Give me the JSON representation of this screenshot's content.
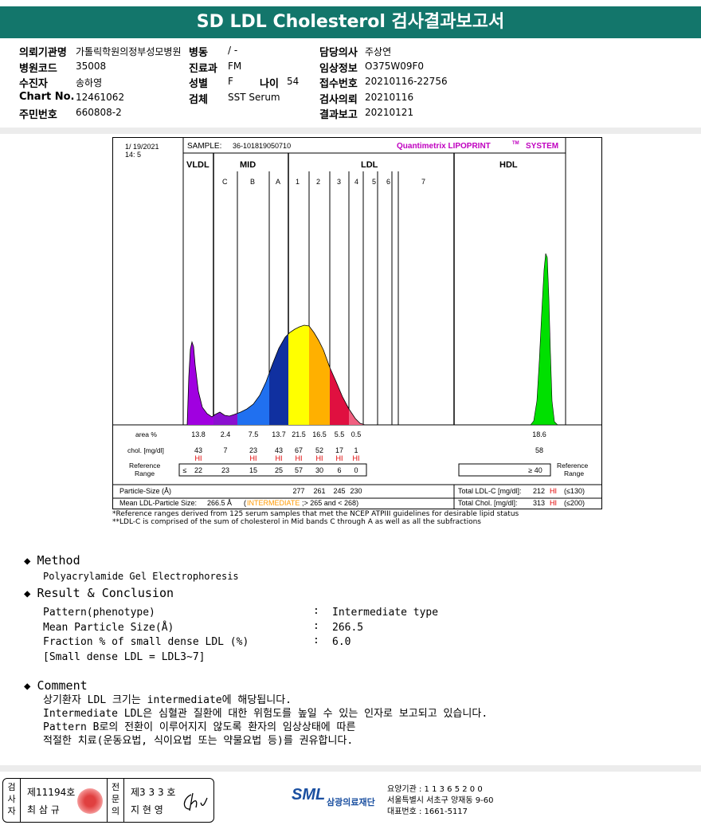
{
  "title": "SD LDL Cholesterol 검사결과보고서",
  "info": {
    "r1": {
      "l1": "의뢰기관명",
      "v1": "가톨릭학원의정부성모병원",
      "l2": "병동",
      "v2": "/ -",
      "l3": "담당의사",
      "v3": "주상연"
    },
    "r2": {
      "l1": "병원코드",
      "v1": "35008",
      "l2": "진료과",
      "v2": "FM",
      "l3": "임상정보",
      "v3": "O375W09F0"
    },
    "r3": {
      "l1": "수진자",
      "v1": "송하영",
      "l2": "성별",
      "v2": "F",
      "l2b": "나이",
      "v2b": "54",
      "l3": "접수번호",
      "v3": "20210116-22756"
    },
    "r4": {
      "l1": "Chart No.",
      "v1": "12461062",
      "l2": "검체",
      "v2": "SST Serum",
      "l3": "검사의뢰",
      "v3": "20210116"
    },
    "r5": {
      "l1": "주민번호",
      "v1": "660808-2",
      "l3": "결과보고",
      "v3": "20210121"
    }
  },
  "report": {
    "date": "1/ 19/2021",
    "time": "14: 5",
    "sample_label": "SAMPLE:",
    "sample_id": "36-101819050710",
    "brand": "Quantimetrix LIPOPRINT",
    "tm": "TM",
    "brand2": "SYSTEM",
    "groups": {
      "vldl": "VLDL",
      "mid": "MID",
      "ldl": "LDL",
      "hdl": "HDL"
    },
    "bands": [
      "C",
      "B",
      "A",
      "1",
      "2",
      "3",
      "4",
      "5",
      "6",
      "7"
    ],
    "row_area_label": "area %",
    "row_chol_label": "chol. [mg/dl]",
    "row_ref_label": "Reference Range",
    "area": [
      "13.8",
      "2.4",
      "7.5",
      "13.7",
      "21.5",
      "16.5",
      "5.5",
      "0.5"
    ],
    "hdl_area": "18.6",
    "chol": [
      "43",
      "7",
      "23",
      "43",
      "67",
      "52",
      "17",
      "1"
    ],
    "hdl_chol": "58",
    "hi_flags": [
      "HI",
      "",
      "HI",
      "HI",
      "HI",
      "HI",
      "HI",
      "HI"
    ],
    "ref": [
      "≤",
      "22",
      "23",
      "15",
      "25",
      "57",
      "30",
      "6",
      "0"
    ],
    "hdl_ref": "≥ 40",
    "ref_right": "Reference Range",
    "particle_label": "Particle-Size (Å)",
    "particle": [
      "277",
      "261",
      "245",
      "230"
    ],
    "total_ldl_label": "Total LDL-C [mg/dl]:",
    "total_ldl": "212",
    "total_ldl_flag": "HI",
    "total_ldl_ref": "(≤130)",
    "mean_label": "Mean LDL-Particle Size:",
    "mean_val": "266.5 Å",
    "mean_type": "INTERMEDIATE",
    "mean_cond": ";> 265 and < 268)",
    "total_chol_label": "Total Chol. [mg/dl]:",
    "total_chol": "313",
    "total_chol_flag": "HI",
    "total_chol_ref": "(≤200)",
    "note1": "*Reference ranges derived from 125 serum samples that met the NCEP ATPIII guidelines for desirable lipid status",
    "note2": "**LDL-C is comprised of the sum of cholesterol in Mid bands C through A as well as all the subfractions"
  },
  "method": {
    "heading": "Method",
    "text": "Polyacrylamide Gel Electrophoresis"
  },
  "result": {
    "heading": "Result & Conclusion",
    "rows": [
      {
        "k": "Pattern(phenotype)",
        "sep": ":",
        "v": "Intermediate type"
      },
      {
        "k": "Mean Particle Size(Å)",
        "sep": ":",
        "v": "266.5"
      },
      {
        "k": "Fraction % of small dense LDL (%)",
        "sep": ":",
        "v": "6.0"
      }
    ],
    "note": "[Small dense LDL = LDL3~7]"
  },
  "comment": {
    "heading": "Comment",
    "lines": [
      "상기환자 LDL 크기는 intermediate에 해당됩니다.",
      "Intermediate LDL은 심혈관 질환에 대한 위험도를 높일 수 있는 인자로 보고되고 있습니다.",
      "Pattern B로의 전환이 이루어지지 않도록 환자의 임상상태에 따른",
      "적절한 치료(운동요법, 식이요법 또는 약물요법 등)를 권유합니다."
    ]
  },
  "footer": {
    "box1_label": [
      "검",
      "사",
      "자"
    ],
    "box1_no": "제11194호",
    "box1_name": "최 삼 규",
    "box2_label": [
      "전",
      "문",
      "의"
    ],
    "box2_no": "제3 3 3 호",
    "box2_name": "지 현 영",
    "logo": "SML",
    "org": "삼광의료재단",
    "line1": "요양기관 : 1 1 3 6 5 2 0 0",
    "line2": "서울특별시 서초구 양재동 9-60",
    "line3": "대표번호 : 1661-5117"
  },
  "colors": {
    "header": "#13766b",
    "hi": "#e00000",
    "brand": "#c000c0",
    "vldl": "#a000e0",
    "mid_c": "#8a10d0",
    "mid_b": "#2070f0",
    "mid_a": "#1030a0",
    "ldl1": "#ffff00",
    "ldl2": "#ffb000",
    "ldl3": "#e01040",
    "hdl": "#00e000",
    "intermediate": "#ff9900"
  }
}
